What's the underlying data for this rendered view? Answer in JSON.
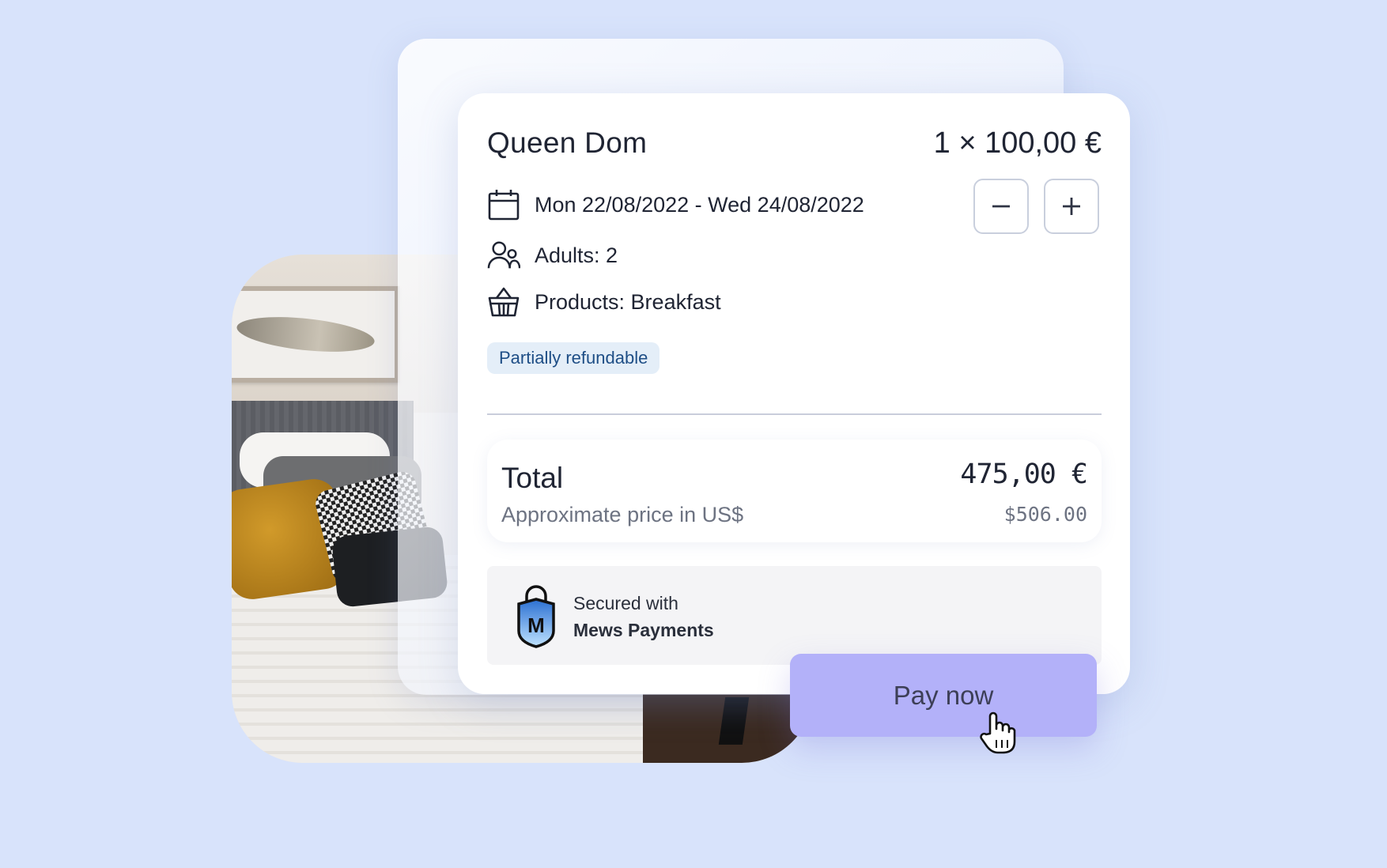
{
  "booking": {
    "room_name": "Queen Dom",
    "price_line": "1 × 100,00 €",
    "dates": "Mon 22/08/2022 - Wed 24/08/2022",
    "adults": "Adults: 2",
    "products": "Products: Breakfast",
    "refund_badge": "Partially refundable",
    "stepper_minus": "−",
    "stepper_plus": "+"
  },
  "totals": {
    "label": "Total",
    "value": "475,00 €",
    "approx_label": "Approximate price in US$",
    "approx_value": "$506.00"
  },
  "security": {
    "line1": "Secured with",
    "line2": "Mews Payments",
    "logo_letter": "M"
  },
  "actions": {
    "pay_label": "Pay now"
  },
  "colors": {
    "background": "#d8e3fb",
    "pay_button": "#b3b1f9",
    "badge_bg": "#e4eef8",
    "badge_text": "#1e4e86"
  },
  "icons": [
    "calendar-icon",
    "users-icon",
    "basket-icon",
    "shield-lock-icon",
    "hand-cursor-icon"
  ]
}
